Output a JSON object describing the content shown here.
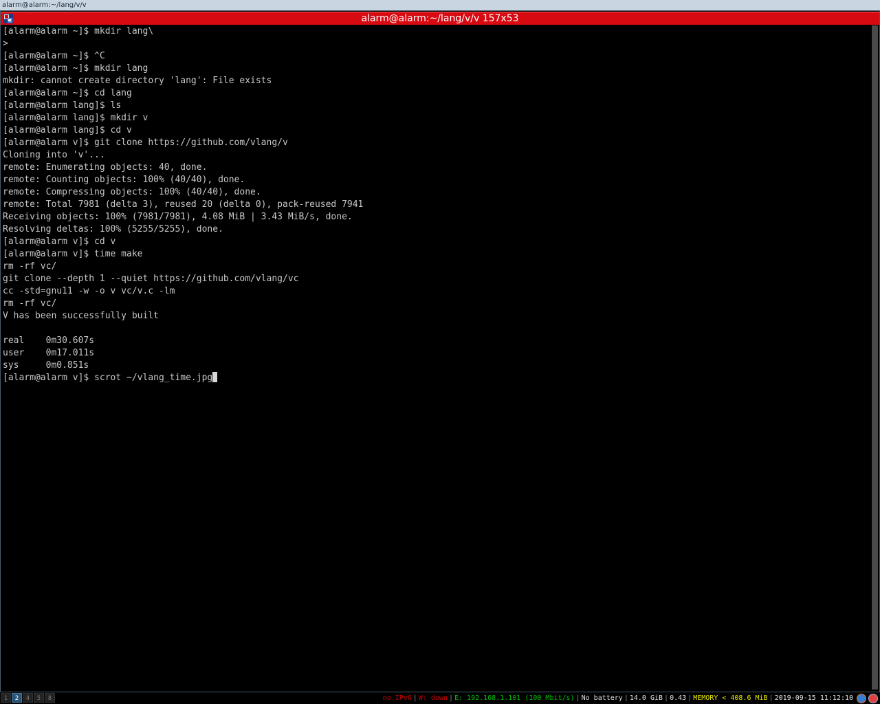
{
  "wm_title": "alarm@alarm:~/lang/v/v",
  "terminal": {
    "title": "alarm@alarm:~/lang/v/v 157x53",
    "lines": [
      "[alarm@alarm ~]$ mkdir lang\\",
      ">",
      "[alarm@alarm ~]$ ^C",
      "[alarm@alarm ~]$ mkdir lang",
      "mkdir: cannot create directory 'lang': File exists",
      "[alarm@alarm ~]$ cd lang",
      "[alarm@alarm lang]$ ls",
      "[alarm@alarm lang]$ mkdir v",
      "[alarm@alarm lang]$ cd v",
      "[alarm@alarm v]$ git clone https://github.com/vlang/v",
      "Cloning into 'v'...",
      "remote: Enumerating objects: 40, done.",
      "remote: Counting objects: 100% (40/40), done.",
      "remote: Compressing objects: 100% (40/40), done.",
      "remote: Total 7981 (delta 3), reused 20 (delta 0), pack-reused 7941",
      "Receiving objects: 100% (7981/7981), 4.08 MiB | 3.43 MiB/s, done.",
      "Resolving deltas: 100% (5255/5255), done.",
      "[alarm@alarm v]$ cd v",
      "[alarm@alarm v]$ time make",
      "rm -rf vc/",
      "git clone --depth 1 --quiet https://github.com/vlang/vc",
      "cc -std=gnu11 -w -o v vc/v.c -lm",
      "rm -rf vc/",
      "V has been successfully built",
      "",
      "real\t0m30.607s",
      "user\t0m17.011s",
      "sys\t0m0.851s"
    ],
    "prompt_line": "[alarm@alarm v]$ scrot ~/vlang_time.jpg"
  },
  "statusbar": {
    "workspaces": [
      {
        "label": "1",
        "active": false
      },
      {
        "label": "2",
        "active": true
      },
      {
        "label": "4",
        "active": false
      },
      {
        "label": "5",
        "active": false
      },
      {
        "label": "8",
        "active": false
      }
    ],
    "items": [
      {
        "name": "ipv6",
        "text": "no IPv6",
        "color": "#d40000"
      },
      {
        "name": "wireless",
        "text": "W: down",
        "color": "#d40000"
      },
      {
        "name": "ethernet",
        "text": "E: 192.168.1.101 (100 Mbit/s)",
        "color": "#00c000"
      },
      {
        "name": "battery",
        "text": "No battery",
        "color": "#e0e0e0"
      },
      {
        "name": "disk",
        "text": "14.0 GiB",
        "color": "#e0e0e0"
      },
      {
        "name": "load",
        "text": "0.43",
        "color": "#e0e0e0"
      },
      {
        "name": "memory",
        "text": "MEMORY < 408.6 MiB",
        "color": "#e6e600"
      },
      {
        "name": "datetime",
        "text": "2019-09-15 11:12:10",
        "color": "#e0e0e0"
      }
    ],
    "tray_icons": [
      "tray-app-icon",
      "tray-network-icon"
    ]
  },
  "colors": {
    "titlebar": "#d70a12",
    "terminal_fg": "#c8c8c8",
    "terminal_bg": "#000000"
  }
}
